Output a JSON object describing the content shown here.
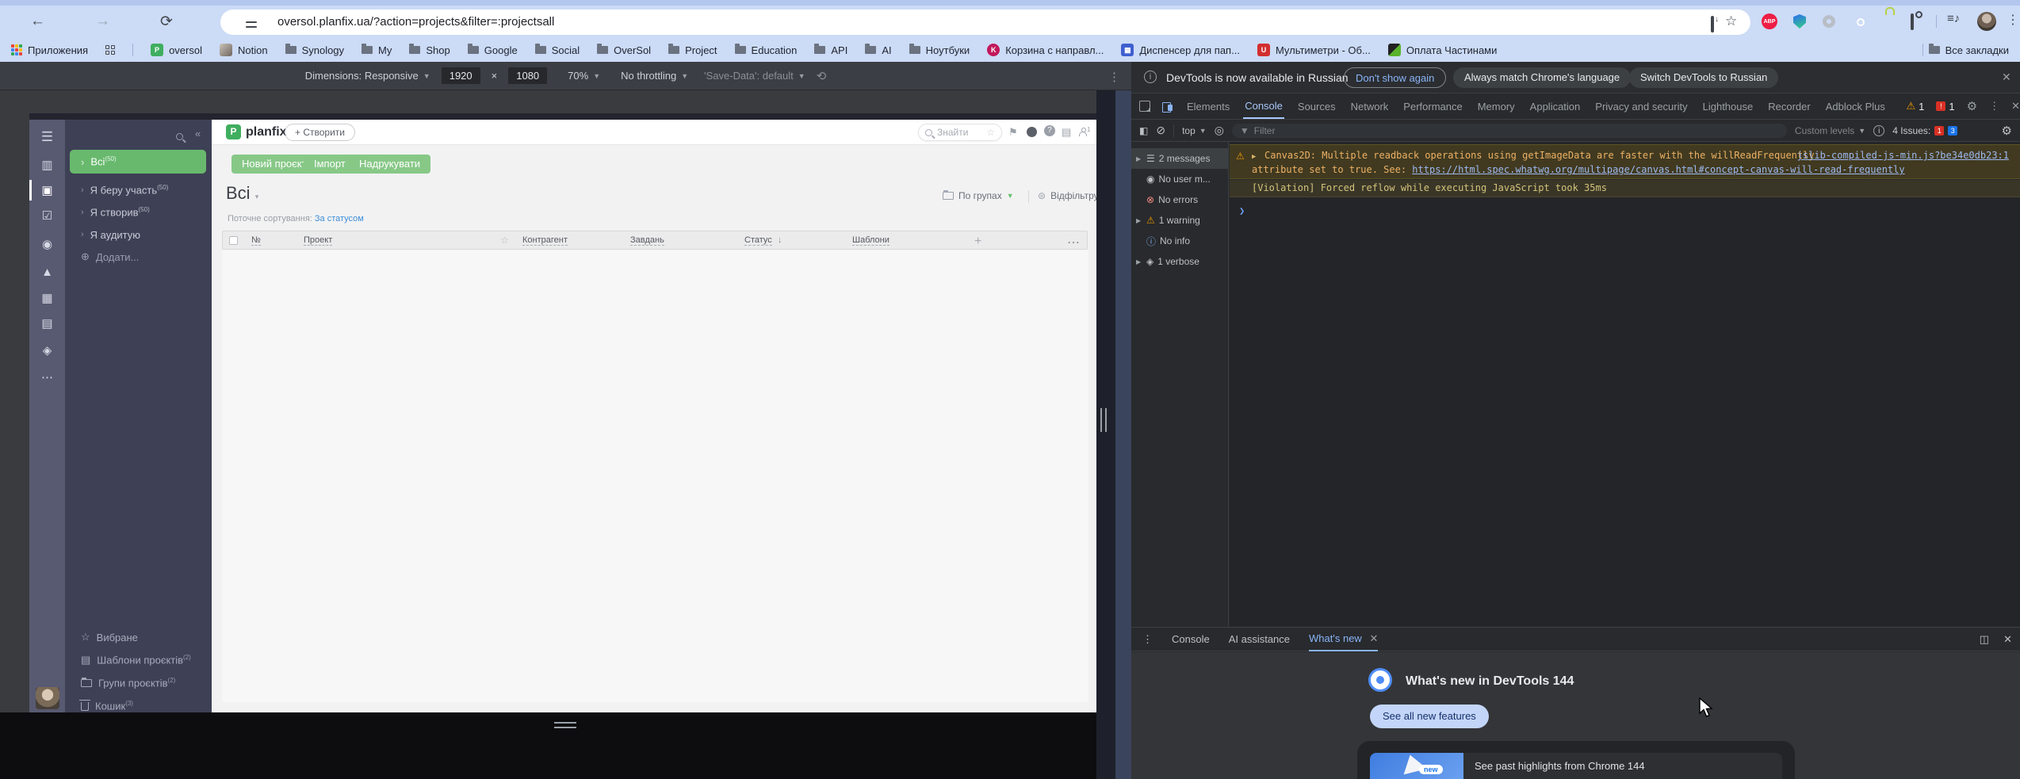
{
  "browser": {
    "url": "oversol.planfix.ua/?action=projects&filter=:projectsall",
    "apps_shortcut": "Приложения",
    "all_bookmarks": "Все закладки",
    "bookmarks": [
      {
        "label": "oversol"
      },
      {
        "label": "Notion"
      },
      {
        "label": "Synology"
      },
      {
        "label": "My"
      },
      {
        "label": "Shop"
      },
      {
        "label": "Google"
      },
      {
        "label": "Social"
      },
      {
        "label": "OverSol"
      },
      {
        "label": "Project"
      },
      {
        "label": "Education"
      },
      {
        "label": "API"
      },
      {
        "label": "AI"
      },
      {
        "label": "Ноутбуки"
      },
      {
        "label": "Корзина с направл..."
      },
      {
        "label": "Диспенсер для пап..."
      },
      {
        "label": "Мультиметри - Об..."
      },
      {
        "label": "Оплата Частинами"
      }
    ],
    "abp_label": "ABP"
  },
  "device_toolbar": {
    "dimensions": "Dimensions: Responsive",
    "width": "1920",
    "times": "×",
    "height": "1080",
    "zoom": "70%",
    "throttling": "No throttling",
    "save_data": "'Save-Data': default"
  },
  "planfix": {
    "logo_letter": "P",
    "logo": "planfix",
    "create_button": "+ Створити",
    "search_placeholder": "Знайти",
    "user_badge": "1",
    "nav": {
      "items": [
        {
          "label": "Всі",
          "count": "(50)"
        },
        {
          "label": "Я беру участь",
          "count": "(50)"
        },
        {
          "label": "Я створив",
          "count": "(50)"
        },
        {
          "label": "Я аудитую",
          "count": ""
        },
        {
          "label": "Додати...",
          "count": ""
        }
      ],
      "bottom_items": [
        {
          "label": "Вибране",
          "count": ""
        },
        {
          "label": "Шаблони проєктів",
          "count": "(2)"
        },
        {
          "label": "Групи проєктів",
          "count": "(2)"
        },
        {
          "label": "Кошик",
          "count": "(3)"
        }
      ]
    },
    "actions": [
      {
        "label": "Новий проєкт"
      },
      {
        "label": "Імпорт"
      },
      {
        "label": "Надрукувати"
      }
    ],
    "view_title": "Всі",
    "group_by": "По групах",
    "filter": "Відфільтрувати",
    "sort_label": "Поточне сортування:",
    "sort_value": "За статусом",
    "table_columns": [
      {
        "label": "№"
      },
      {
        "label": "Проект"
      },
      {
        "label": "Контрагент"
      },
      {
        "label": "Завдань"
      },
      {
        "label": "Статус"
      },
      {
        "label": "Шаблони"
      }
    ]
  },
  "devtools": {
    "banner": {
      "message": "DevTools is now available in Russian",
      "dont_show": "Don't show again",
      "match_language": "Always match Chrome's language",
      "switch_russian": "Switch DevTools to Russian"
    },
    "tabs": [
      {
        "label": "Elements"
      },
      {
        "label": "Console"
      },
      {
        "label": "Sources"
      },
      {
        "label": "Network"
      },
      {
        "label": "Performance"
      },
      {
        "label": "Memory"
      },
      {
        "label": "Application"
      },
      {
        "label": "Privacy and security"
      },
      {
        "label": "Lighthouse"
      },
      {
        "label": "Recorder"
      },
      {
        "label": "Adblock Plus"
      }
    ],
    "warning_count": "1",
    "error_count": "1",
    "console_toolbar": {
      "context": "top",
      "filter_placeholder": "Filter",
      "levels": "Custom levels",
      "issues_label": "4 Issues:",
      "issues_red": "1",
      "issues_blue": "3"
    },
    "console_sidebar": [
      {
        "label": "2 messages"
      },
      {
        "label": "No user m..."
      },
      {
        "label": "No errors"
      },
      {
        "label": "1 warning"
      },
      {
        "label": "No info"
      },
      {
        "label": "1 verbose"
      }
    ],
    "console": {
      "warning_line1": "Canvas2D: Multiple readback operations using getImageData are faster with the willReadFrequently",
      "warning_line2_prefix": "attribute set to true. See: ",
      "warning_link": "https://html.spec.whatwg.org/multipage/canvas.html#concept-canvas-will-read-frequently",
      "warning_source": "jslib-compiled-js-min.js?be34e0db23:1",
      "violation": "[Violation] Forced reflow while executing JavaScript took 35ms"
    },
    "drawer_tabs": [
      {
        "label": "Console"
      },
      {
        "label": "AI assistance"
      },
      {
        "label": "What's new"
      }
    ],
    "whats_new": {
      "title": "What's new in DevTools 144",
      "see_all": "See all new features",
      "new_badge": "new",
      "highlight": "See past highlights from Chrome 144"
    }
  }
}
